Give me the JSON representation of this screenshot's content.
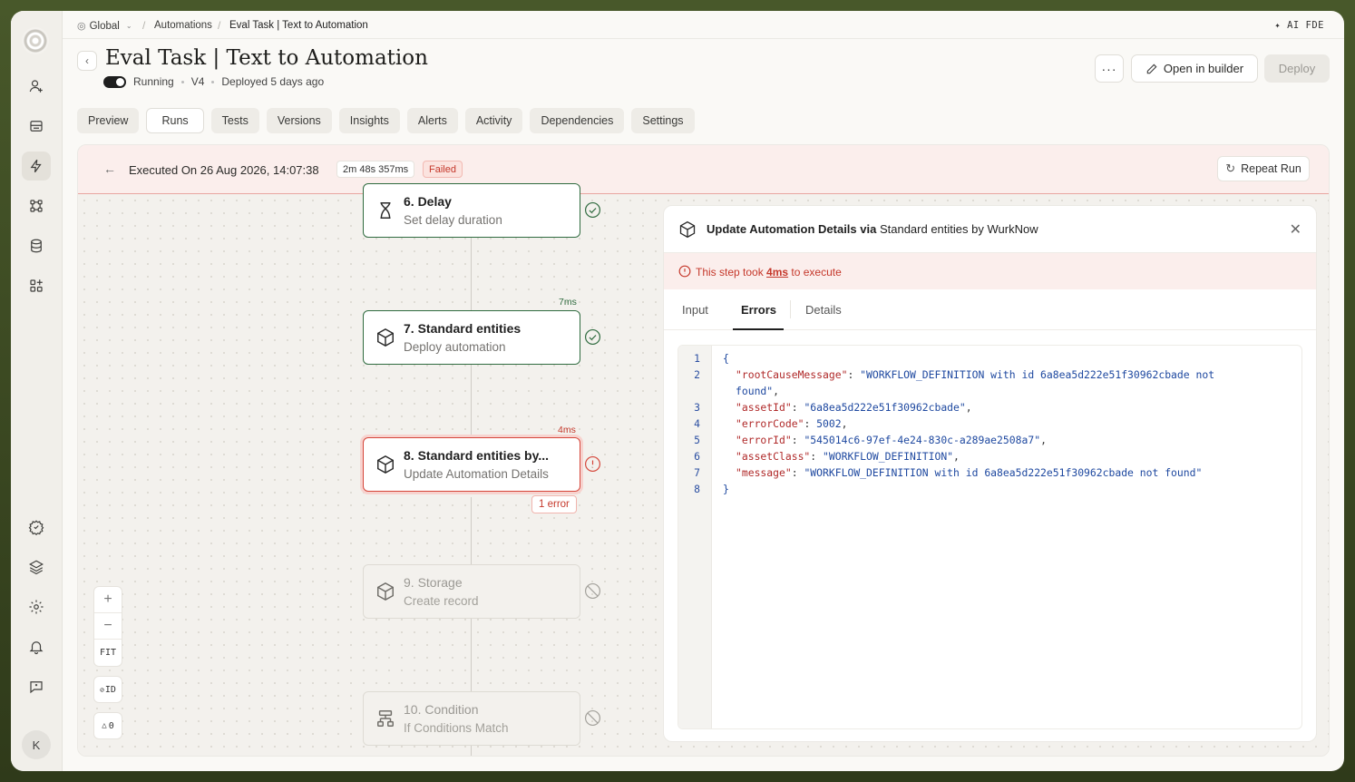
{
  "breadcrumb": {
    "scope": "Global",
    "section": "Automations",
    "current": "Eval Task | Text to Automation"
  },
  "ai_fde": "AI FDE",
  "header": {
    "title": "Eval Task | Text to Automation",
    "status": "Running",
    "version": "V4",
    "deployed": "Deployed 5 days ago",
    "open_builder": "Open in builder",
    "deploy": "Deploy"
  },
  "tabs": [
    "Preview",
    "Runs",
    "Tests",
    "Versions",
    "Insights",
    "Alerts",
    "Activity",
    "Dependencies",
    "Settings"
  ],
  "active_tab": "Runs",
  "run": {
    "executed": "Executed On 26 Aug 2026, 14:07:38",
    "duration": "2m 48s 357ms",
    "status": "Failed",
    "repeat": "Repeat Run"
  },
  "nodes": [
    {
      "title": "6. Delay",
      "subtitle": "Set delay duration",
      "icon": "hourglass-icon",
      "state": "success",
      "time": ""
    },
    {
      "title": "7. Standard entities",
      "subtitle": "Deploy automation",
      "icon": "cube-icon",
      "state": "success",
      "time": "7ms"
    },
    {
      "title": "8. Standard entities by...",
      "subtitle": "Update Automation Details",
      "icon": "cube-icon",
      "state": "error",
      "time": "4ms",
      "error_count": "1 error"
    },
    {
      "title": "9. Storage",
      "subtitle": "Create record",
      "icon": "cube-icon",
      "state": "skipped",
      "time": ""
    },
    {
      "title": "10. Condition",
      "subtitle": "If Conditions Match",
      "icon": "branch-icon",
      "state": "skipped",
      "time": ""
    }
  ],
  "zoom_controls": {
    "zoom_in": "+",
    "zoom_out": "−",
    "fit": "FIT",
    "id_toggle": "ID",
    "warnings": "0"
  },
  "detail": {
    "title_bold_1": "Update Automation Details",
    "title_via": " via ",
    "title_rest": "Standard entities",
    "title_by": " by ",
    "title_vendor": "WurkNow",
    "alert_prefix": "This step took ",
    "alert_time": "4ms",
    "alert_suffix": " to execute",
    "tabs": [
      "Input",
      "Errors",
      "Details"
    ],
    "active_tab": "Errors"
  },
  "code_lines": [
    {
      "n": "1",
      "text": "{"
    },
    {
      "n": "2",
      "key": "\"rootCauseMessage\"",
      "value": "\"WORKFLOW_DEFINITION with id 6a8ea5d222e51f30962cbade not"
    },
    {
      "n": "",
      "value": "found\"",
      "tail": ","
    },
    {
      "n": "3",
      "key": "\"assetId\"",
      "value": "\"6a8ea5d222e51f30962cbade\"",
      "tail": ","
    },
    {
      "n": "4",
      "key": "\"errorCode\"",
      "value": "5002",
      "tail": ","
    },
    {
      "n": "5",
      "key": "\"errorId\"",
      "value": "\"545014c6-97ef-4e24-830c-a289ae2508a7\"",
      "tail": ","
    },
    {
      "n": "6",
      "key": "\"assetClass\"",
      "value": "\"WORKFLOW_DEFINITION\"",
      "tail": ","
    },
    {
      "n": "7",
      "key": "\"message\"",
      "value": "\"WORKFLOW_DEFINITION with id 6a8ea5d222e51f30962cbade not found\""
    },
    {
      "n": "8",
      "text": "}"
    }
  ],
  "user_initial": "K",
  "colors": {
    "success": "#2f6b3f",
    "error": "#d5463a",
    "skipped": "#a3a19b"
  }
}
